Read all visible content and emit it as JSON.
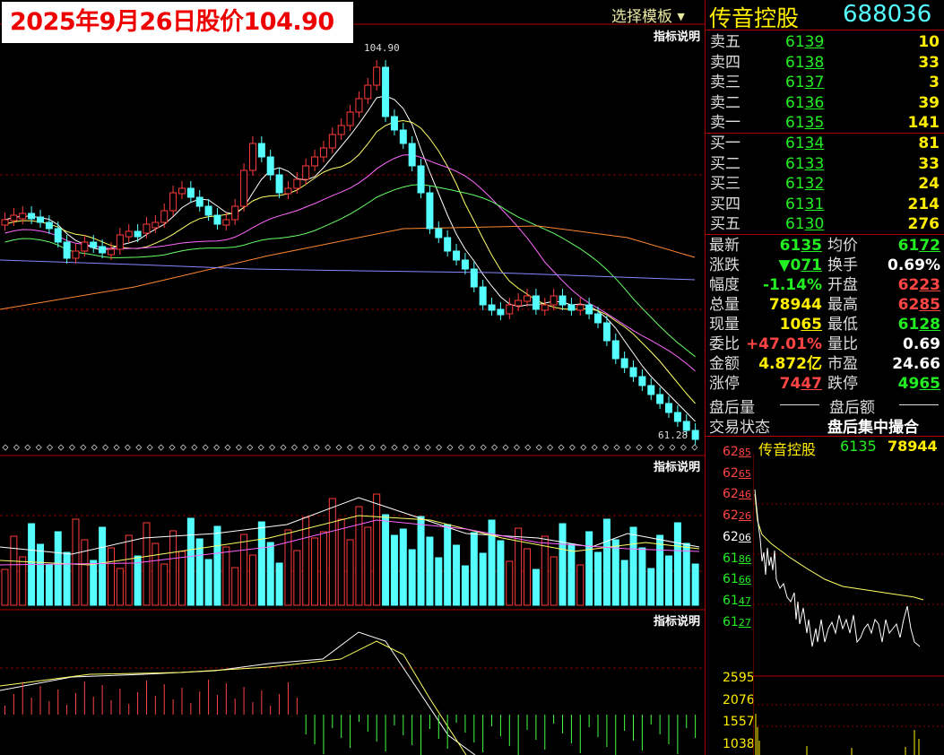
{
  "banner": {
    "title": "2025年9月26日股价104.90"
  },
  "header": {
    "template_menu": "选择模板",
    "stock_name": "传音控股",
    "stock_code": "688036",
    "indicator_label": "指标说明"
  },
  "chart": {
    "max_label": "104.90",
    "min_label": "61.28",
    "colors": {
      "up": "#ff3b3b",
      "down": "#55ffff",
      "ma5": "#ffffff",
      "ma10": "#ffff66",
      "ma20": "#ff66ff",
      "ma30": "#66ff66",
      "ma60": "#ff8833",
      "ma120": "#8888ff"
    }
  },
  "order_book": {
    "asks": [
      {
        "label": "卖五",
        "price": "6139",
        "volume": "10"
      },
      {
        "label": "卖四",
        "price": "6138",
        "volume": "33"
      },
      {
        "label": "卖三",
        "price": "6137",
        "volume": "3"
      },
      {
        "label": "卖二",
        "price": "6136",
        "volume": "39"
      },
      {
        "label": "卖一",
        "price": "6135",
        "volume": "141"
      }
    ],
    "bids": [
      {
        "label": "买一",
        "price": "6134",
        "volume": "81"
      },
      {
        "label": "买二",
        "price": "6133",
        "volume": "33"
      },
      {
        "label": "买三",
        "price": "6132",
        "volume": "24"
      },
      {
        "label": "买四",
        "price": "6131",
        "volume": "214"
      },
      {
        "label": "买五",
        "price": "6130",
        "volume": "276"
      }
    ]
  },
  "quote": {
    "left": [
      {
        "label": "最新",
        "value": "6135",
        "color": "#22ee22"
      },
      {
        "label": "涨跌",
        "value": "▼071",
        "color": "#22ee22"
      },
      {
        "label": "幅度",
        "value": "-1.14%",
        "color": "#22ee22"
      },
      {
        "label": "总量",
        "value": "78944",
        "color": "#ffee00"
      },
      {
        "label": "现量",
        "value": "1065",
        "color": "#ffee00"
      },
      {
        "label": "委比",
        "value": "+47.01%",
        "color": "#ff4444"
      },
      {
        "label": "金额",
        "value": "4.872亿",
        "color": "#ffee00"
      },
      {
        "label": "涨停",
        "value": "7447",
        "color": "#ff4444"
      }
    ],
    "right": [
      {
        "label": "均价",
        "value": "6172",
        "color": "#22ee22"
      },
      {
        "label": "换手",
        "value": "0.69%",
        "color": "#ffffff"
      },
      {
        "label": "开盘",
        "value": "6223",
        "color": "#ff4444"
      },
      {
        "label": "最高",
        "value": "6285",
        "color": "#ff4444"
      },
      {
        "label": "最低",
        "value": "6128",
        "color": "#22ee22"
      },
      {
        "label": "量比",
        "value": "0.69",
        "color": "#ffffff"
      },
      {
        "label": "市盈",
        "value": "24.66",
        "color": "#ffffff"
      },
      {
        "label": "跌停",
        "value": "4965",
        "color": "#22ee22"
      }
    ],
    "after_hours_volume": "盘后量",
    "after_hours_amount": "盘后额",
    "trade_status_label": "交易状态",
    "trade_status_value": "盘后集中撮合"
  },
  "intraday": {
    "name": "传音控股",
    "price": "6135",
    "volume": "78944",
    "price_ticks": [
      "6285",
      "6265",
      "6246",
      "6226",
      "6206",
      "6186",
      "6166",
      "6147",
      "6127"
    ],
    "volume_ticks": [
      "2595",
      "2076",
      "1557",
      "1038"
    ]
  }
}
